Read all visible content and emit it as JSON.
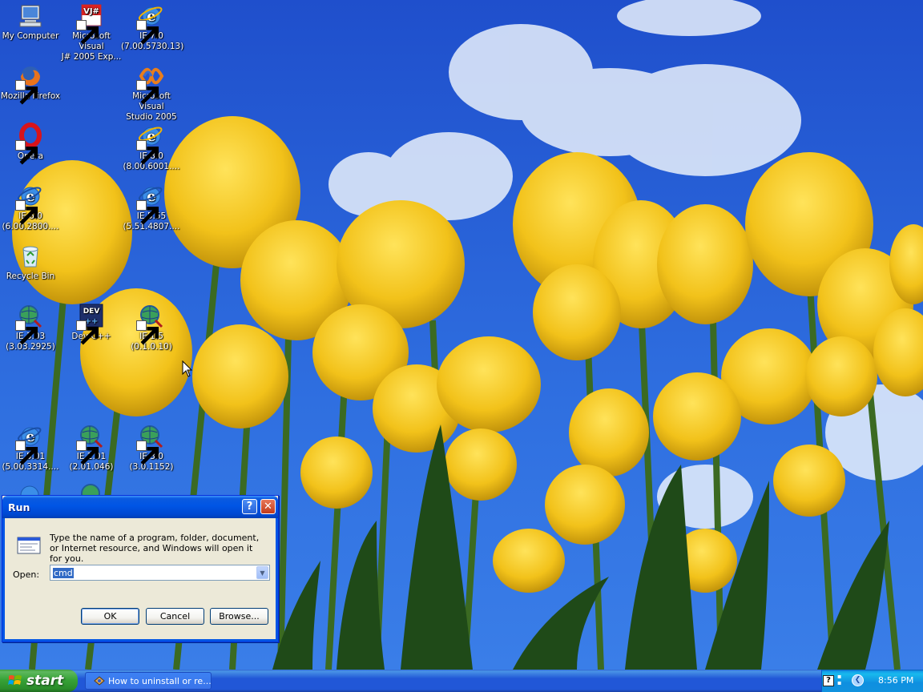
{
  "desktop": {
    "icons": [
      {
        "label": "My Computer",
        "icon": "my-computer-icon"
      },
      {
        "label": "Microsoft Visual\nJ# 2005 Exp...",
        "icon": "visual-j-sharp-icon"
      },
      {
        "label": "IE 7.0\n(7.00.5730.13)",
        "icon": "internet-explorer-icon"
      },
      {
        "label": "Mozilla Firefox",
        "icon": "firefox-icon"
      },
      {
        "label": "Microsoft Visual\nStudio 2005",
        "icon": "visual-studio-icon"
      },
      {
        "label": "Opera",
        "icon": "opera-icon"
      },
      {
        "label": "IE 8.0\n(8.00.6001....",
        "icon": "internet-explorer-icon"
      },
      {
        "label": "IE 6.0\n(6.00.2800....",
        "icon": "internet-explorer-icon"
      },
      {
        "label": "IE 5.55\n(5.51.4807....",
        "icon": "internet-explorer-icon"
      },
      {
        "label": "Recycle Bin",
        "icon": "recycle-bin-icon"
      },
      {
        "label": "IE 3.03\n(3.03.2925)",
        "icon": "old-ie-globe-icon"
      },
      {
        "label": "Dev-C++",
        "icon": "dev-cpp-icon"
      },
      {
        "label": "IE 1.5\n(0.1.0.10)",
        "icon": "old-ie-globe-icon"
      },
      {
        "label": "IE 5.01\n(5.00.3314....",
        "icon": "internet-explorer-icon"
      },
      {
        "label": "IE 2.01\n(2.01.046)",
        "icon": "old-ie-globe-icon"
      },
      {
        "label": "IE 3.0\n(3.0.1152)",
        "icon": "old-ie-globe-icon"
      }
    ]
  },
  "run_dialog": {
    "title": "Run",
    "help_label": "?",
    "close_label": "✕",
    "description": "Type the name of a program, folder, document, or Internet resource, and Windows will open it for you.",
    "open_label": "Open:",
    "open_value": "cmd",
    "ok_label": "OK",
    "cancel_label": "Cancel",
    "browse_label": "Browse..."
  },
  "taskbar": {
    "start_label": "start",
    "task_label": "How to uninstall or re...",
    "tray_help": "?",
    "clock": "8:56 PM"
  },
  "colors": {
    "sky": "#2a62d6",
    "tulip": "#f2c81a",
    "titlebar": "#0055e5",
    "dialog_face": "#ece9d8"
  }
}
